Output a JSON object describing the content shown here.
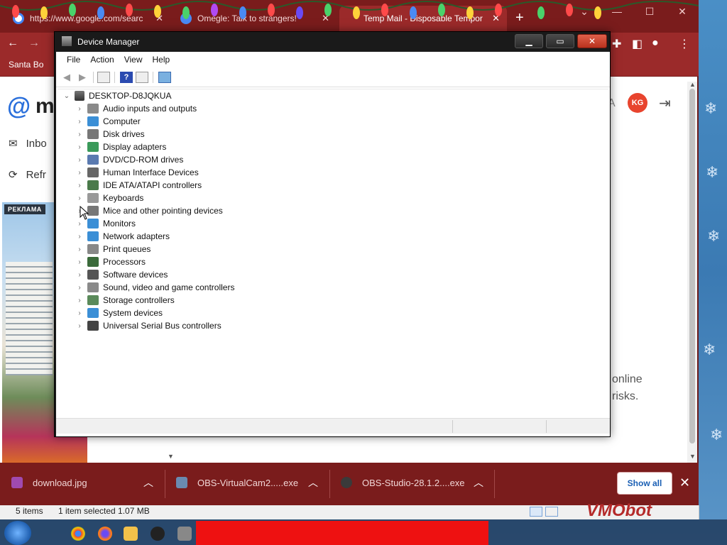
{
  "browser": {
    "tabs": [
      {
        "label": "https://www.google.com/searc",
        "close": "✕",
        "color": "#ffffff"
      },
      {
        "label": "Omegle: Talk to strangers!",
        "close": "✕",
        "color": "#4a8af4"
      },
      {
        "label": "Temp Mail - Disposable Tempor",
        "close": "✕",
        "color": "#ffffff"
      }
    ],
    "new_tab": "+",
    "bookmark": "Santa Bo",
    "page": {
      "logo_at": "@",
      "logo_m": "m",
      "nav_inbox": "Inbo",
      "nav_refresh": "Refr",
      "ad_label": "РЕКЛАМА",
      "avatar": "KG",
      "side_text_1": "online",
      "side_text_2": "risks."
    }
  },
  "device_manager": {
    "title": "Device Manager",
    "menu": [
      "File",
      "Action",
      "View",
      "Help"
    ],
    "root": "DESKTOP-D8JQKUA",
    "categories": [
      {
        "label": "Audio inputs and outputs",
        "icon": "speaker-icon",
        "color": "#8a8a8a"
      },
      {
        "label": "Computer",
        "icon": "computer-icon",
        "color": "#3b8fd6"
      },
      {
        "label": "Disk drives",
        "icon": "disk-icon",
        "color": "#777777"
      },
      {
        "label": "Display adapters",
        "icon": "display-adapter-icon",
        "color": "#3a9a5a"
      },
      {
        "label": "DVD/CD-ROM drives",
        "icon": "dvd-icon",
        "color": "#5a7ab0"
      },
      {
        "label": "Human Interface Devices",
        "icon": "hid-icon",
        "color": "#666666"
      },
      {
        "label": "IDE ATA/ATAPI controllers",
        "icon": "ide-icon",
        "color": "#4a7a4a"
      },
      {
        "label": "Keyboards",
        "icon": "keyboard-icon",
        "color": "#999999"
      },
      {
        "label": "Mice and other pointing devices",
        "icon": "mouse-icon",
        "color": "#777777"
      },
      {
        "label": "Monitors",
        "icon": "monitor-icon",
        "color": "#3b8fd6"
      },
      {
        "label": "Network adapters",
        "icon": "network-icon",
        "color": "#3b8fd6"
      },
      {
        "label": "Print queues",
        "icon": "printer-icon",
        "color": "#888888"
      },
      {
        "label": "Processors",
        "icon": "processor-icon",
        "color": "#3a6a3a"
      },
      {
        "label": "Software devices",
        "icon": "software-icon",
        "color": "#555555"
      },
      {
        "label": "Sound, video and game controllers",
        "icon": "sound-icon",
        "color": "#8a8a8a"
      },
      {
        "label": "Storage controllers",
        "icon": "storage-icon",
        "color": "#5a8a5a"
      },
      {
        "label": "System devices",
        "icon": "system-icon",
        "color": "#3b8fd6"
      },
      {
        "label": "Universal Serial Bus controllers",
        "icon": "usb-icon",
        "color": "#444444"
      }
    ]
  },
  "downloads": {
    "items": [
      {
        "name": "download.jpg",
        "color": "#a04ab0"
      },
      {
        "name": "OBS-VirtualCam2.....exe",
        "color": "#6a8ab0"
      },
      {
        "name": "OBS-Studio-28.1.2....exe",
        "color": "#3a3a3a"
      }
    ],
    "show_all": "Show all"
  },
  "explorer_status": {
    "items": "5 items",
    "selected": "1 item selected  1.07 MB"
  },
  "overlay_text": "VMObot"
}
